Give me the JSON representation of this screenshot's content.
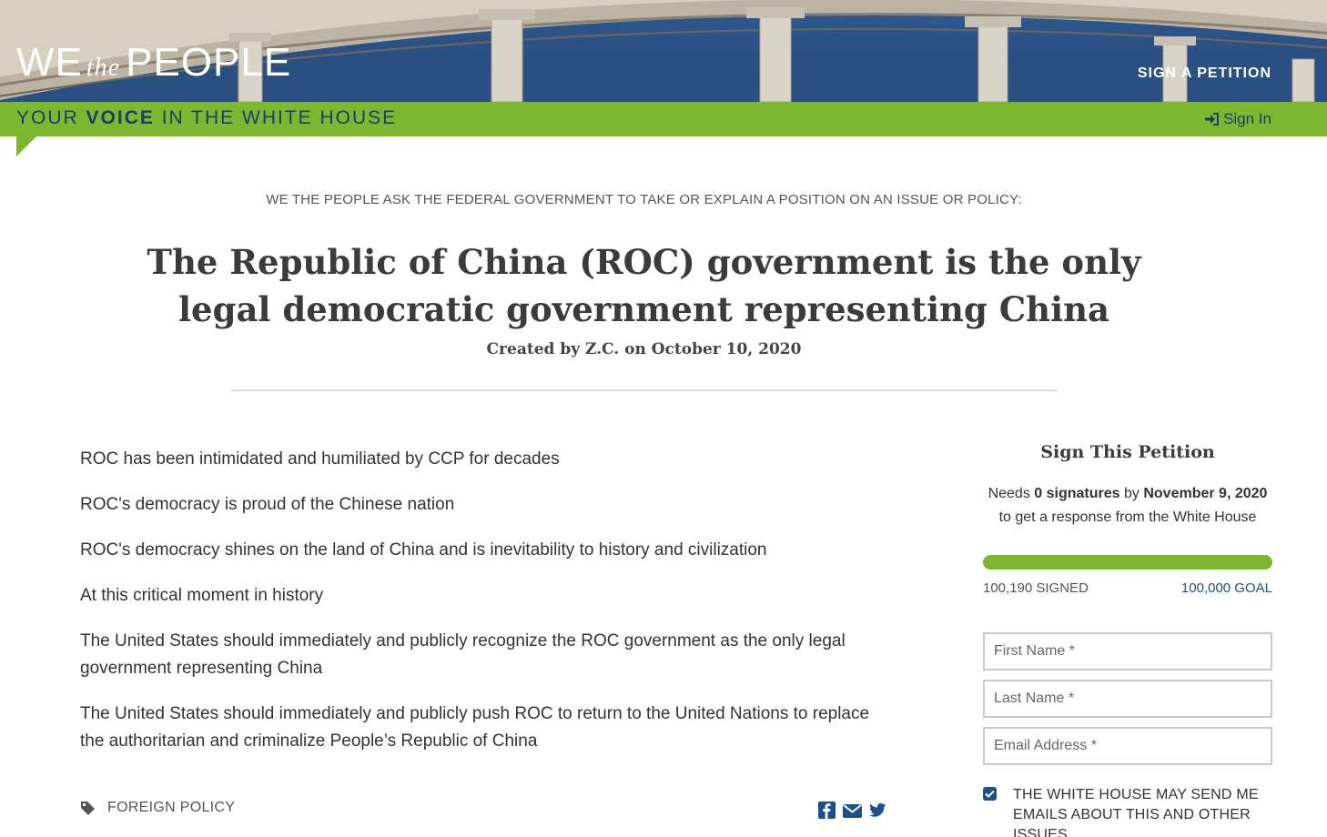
{
  "header": {
    "logo": {
      "we": "WE",
      "the": "the",
      "people": "PEOPLE"
    },
    "nav_sign_petition": "SIGN A PETITION"
  },
  "greenbar": {
    "tagline_pre": "YOUR ",
    "tagline_bold": "VOICE",
    "tagline_post": " IN THE WHITE HOUSE",
    "sign_in": "Sign In",
    "icons": {
      "sign_in": "sign-in-icon"
    }
  },
  "petition": {
    "preamble": "WE THE PEOPLE ASK THE FEDERAL GOVERNMENT TO TAKE OR EXPLAIN A POSITION ON AN ISSUE OR POLICY:",
    "title": "The Republic of China (ROC) government is the only legal democratic government representing China",
    "byline": "Created by Z.C. on October 10, 2020",
    "paragraphs": [
      "ROC has been intimidated and humiliated by CCP for decades",
      "ROC's democracy is proud of the Chinese nation",
      "ROC's democracy shines on the land of China and is inevitability to history and civilization",
      "At this critical moment in history",
      "The United States should immediately and publicly recognize the ROC government as the only legal government representing China",
      "The United States should immediately and publicly push ROC to return to the United Nations to replace the authoritarian and criminalize People’s Republic of China"
    ],
    "tag": "FOREIGN POLICY"
  },
  "sign_panel": {
    "heading": "Sign This Petition",
    "needs_pre": "Needs ",
    "needs_count": "0 signatures",
    "needs_mid": " by ",
    "needs_date": "November 9, 2020",
    "needs_post": "to get a response from the White House",
    "signed": "100,190 SIGNED",
    "goal": "100,000 GOAL",
    "progress_fraction": 1.0,
    "first_name_placeholder": "First Name *",
    "last_name_placeholder": "Last Name *",
    "email_placeholder": "Email Address *",
    "optin_label": "THE WHITE HOUSE MAY SEND ME EMAILS ABOUT THIS AND OTHER ISSUES",
    "optin_checked": true
  },
  "colors": {
    "green": "#7db72f",
    "navy": "#1f3d68",
    "link_blue": "#1f4e8c"
  }
}
